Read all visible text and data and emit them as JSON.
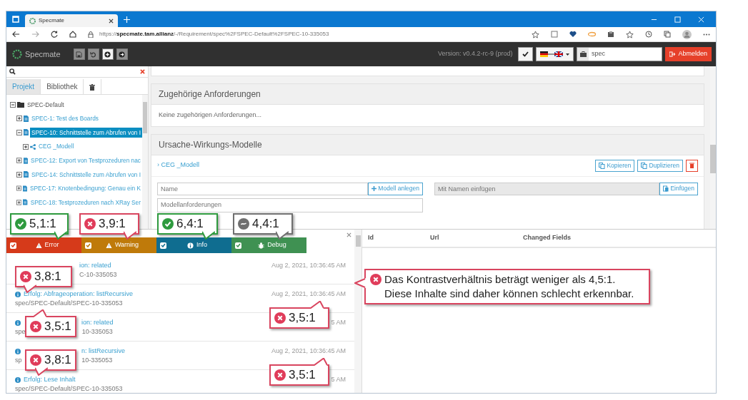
{
  "browser": {
    "tab_title": "Specmate",
    "url": "https://**specmate.tam.allianz**/-/Requirement/spec%2FSPEC-Default%2FSPEC-10-335053"
  },
  "app": {
    "logo": "Specmate",
    "toolbar": [
      {
        "kind": "save",
        "disabled": true
      },
      {
        "kind": "undo",
        "disabled": true
      },
      {
        "kind": "add",
        "disabled": false
      },
      {
        "kind": "forward",
        "disabled": true
      }
    ],
    "version": "Version: v0.4.2-rc-9 (prod)",
    "search": {
      "value": "spec"
    },
    "logout": "Abmelden"
  },
  "sidebar": {
    "tabs": [
      {
        "kind": "text",
        "label": "Projekt",
        "selected": true
      },
      {
        "kind": "text",
        "label": "Bibliothek",
        "selected": false
      },
      {
        "kind": "trash",
        "selected": false
      }
    ],
    "tree": [
      {
        "kind": "folder",
        "label": "SPEC-Default",
        "expanded": true,
        "selected": false,
        "children": [
          {
            "kind": "document",
            "label": "SPEC-1: Test des Boards",
            "expanded": false,
            "selected": false
          },
          {
            "kind": "document",
            "label": "SPEC-10: Schnittstelle zum Abrufen von I",
            "expanded": true,
            "selected": true,
            "children": [
              {
                "kind": "model",
                "label": "CEG _Modell",
                "expanded": false,
                "selected": false
              }
            ]
          },
          {
            "kind": "document",
            "label": "SPEC-12: Export von Testprozeduren nac",
            "expanded": false,
            "selected": false
          },
          {
            "kind": "document",
            "label": "SPEC-14: Schnittstelle zum Abrufen von I",
            "expanded": false,
            "selected": false
          },
          {
            "kind": "document",
            "label": "SPEC-17: Knotenbedingung: Genau ein K",
            "expanded": false,
            "selected": false
          },
          {
            "kind": "document",
            "label": "SPEC-18: Testprozeduren nach XRay Ser",
            "expanded": false,
            "selected": false
          }
        ]
      }
    ]
  },
  "related": {
    "title": "Zugehörige Anforderungen",
    "text": "Keine zugehörigen Anforderungen..."
  },
  "models": {
    "title": "Ursache-Wirkungs-Modelle",
    "items": [
      {
        "label": "› CEG _Modell"
      }
    ],
    "copy": "Kopieren",
    "duplicate": "Duplizieren",
    "name_placeholder": "Name",
    "create": "Modell anlegen",
    "paste_placeholder": "Mit Namen einfügen",
    "paste": "Einfügen",
    "requirements_placeholder": "Modellanforderungen"
  },
  "log": {
    "filters": [
      {
        "kind": "error",
        "label": "Error",
        "checked": true,
        "color": "#d63a1a"
      },
      {
        "kind": "warning",
        "label": "Warning",
        "checked": true,
        "color": "#bf7a0a"
      },
      {
        "kind": "info",
        "label": "Info",
        "checked": true,
        "color": "#0f6d90"
      },
      {
        "kind": "debug",
        "label": "Debug",
        "checked": true,
        "color": "#3f9152"
      }
    ],
    "rows": [
      {
        "message": [
          "ion: related"
        ],
        "path": [
          "C-10-335053"
        ],
        "time": "Aug 2, 2021, 10:36:45 AM"
      },
      {
        "message": [
          "Erfolg: Abfrageoperation: listRecursive"
        ],
        "path": [
          "spec/SPEC-Default/SPEC-10-335053"
        ],
        "time": "Aug 2, 2021, 10:36:45 AM"
      },
      {
        "message": [
          "ion: related"
        ],
        "path": [
          "spe",
          "10-335053"
        ],
        "time": "5 AM"
      },
      {
        "message": [
          "n: listRecursive"
        ],
        "path": [
          "sp",
          "10-335053"
        ],
        "time": "Aug 2, 2021, 10:36:45 AM"
      },
      {
        "message": [
          "Erfolg: Lese Inhalt"
        ],
        "path": [
          "spec/SPEC-Default/SPEC-10-335053"
        ],
        "time": "5 AM"
      }
    ]
  },
  "changes": {
    "columns": [
      "Id",
      "Url",
      "Changed Fields"
    ]
  },
  "annotations": [
    {
      "kind": "pass",
      "text": "5,1:1"
    },
    {
      "kind": "fail",
      "text": "3,9:1"
    },
    {
      "kind": "pass",
      "text": "6,4:1"
    },
    {
      "kind": "neutral",
      "text": "4,4:1"
    },
    {
      "kind": "fail",
      "text": "3,8:1"
    },
    {
      "kind": "fail",
      "text": "3,5:1"
    },
    {
      "kind": "fail",
      "text": "3,8:1"
    },
    {
      "kind": "fail",
      "text": "3,5:1"
    },
    {
      "kind": "fail",
      "text": "3,5:1"
    },
    {
      "kind": "fail",
      "text": "Das Kontrastverhältnis beträgt weniger als 4,5:1. Diese Inhalte sind daher können schlecht erkennbar."
    }
  ]
}
